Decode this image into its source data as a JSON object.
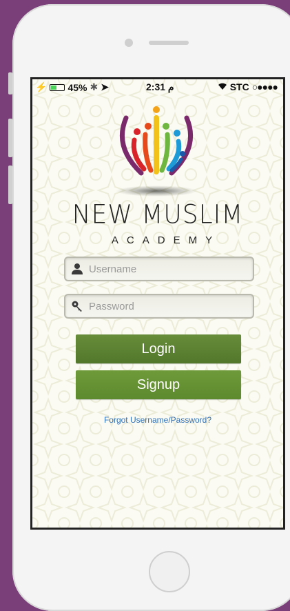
{
  "status_bar": {
    "battery_percent": "45%",
    "battery_level": 0.45,
    "time": "م 2:31",
    "carrier": "STC"
  },
  "brand": {
    "title": "NEW MUSLIM",
    "subtitle": "ACADEMY",
    "logo_icon": "people-circle-logo"
  },
  "login_form": {
    "username_placeholder": "Username",
    "password_placeholder": "Password",
    "login_label": "Login",
    "signup_label": "Signup",
    "forgot_link": "Forgot Username/Password?"
  },
  "colors": {
    "background": "#7a3e78",
    "button_green": "#5d8a2e",
    "link_blue": "#2f6fb5"
  }
}
